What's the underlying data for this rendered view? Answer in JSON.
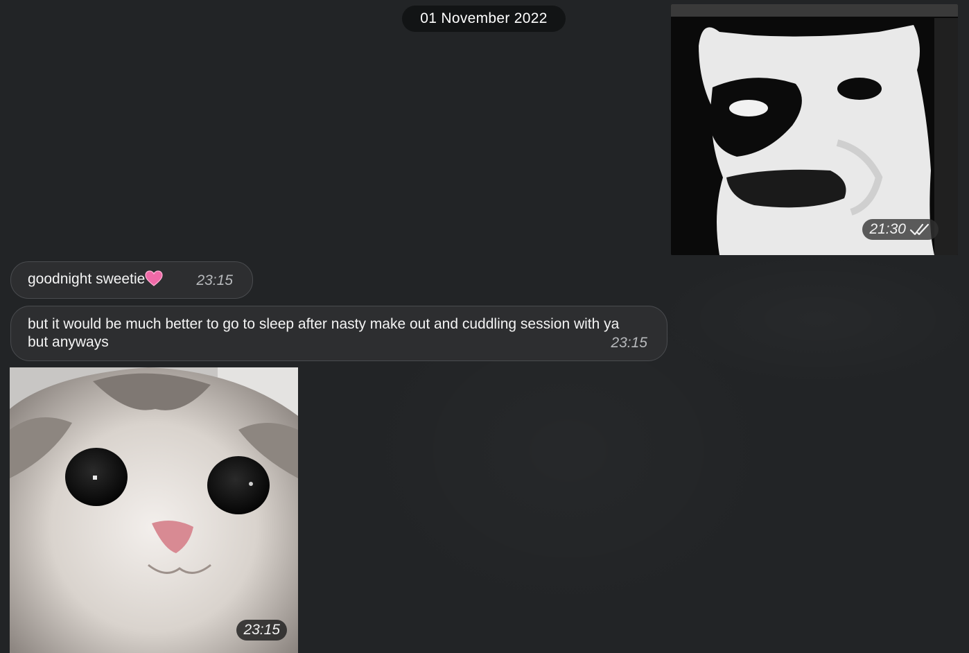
{
  "chat": {
    "date_separator": "01 November 2022",
    "messages": [
      {
        "direction": "outgoing",
        "kind": "photo",
        "time": "21:30",
        "status_icon": "double-check-icon"
      },
      {
        "direction": "incoming",
        "kind": "text",
        "text": "goodnight sweetie",
        "emoji_icon": "pink-heart-icon",
        "time": "23:15"
      },
      {
        "direction": "incoming",
        "kind": "text",
        "text": "but it would be much better to go to sleep after nasty make out and cuddling session with ya but anyways",
        "time": "23:15"
      },
      {
        "direction": "incoming",
        "kind": "photo",
        "time": "23:15"
      }
    ]
  },
  "colors": {
    "background": "#222426",
    "bubble": "#2d2e30",
    "heart": "#f06aa8"
  }
}
